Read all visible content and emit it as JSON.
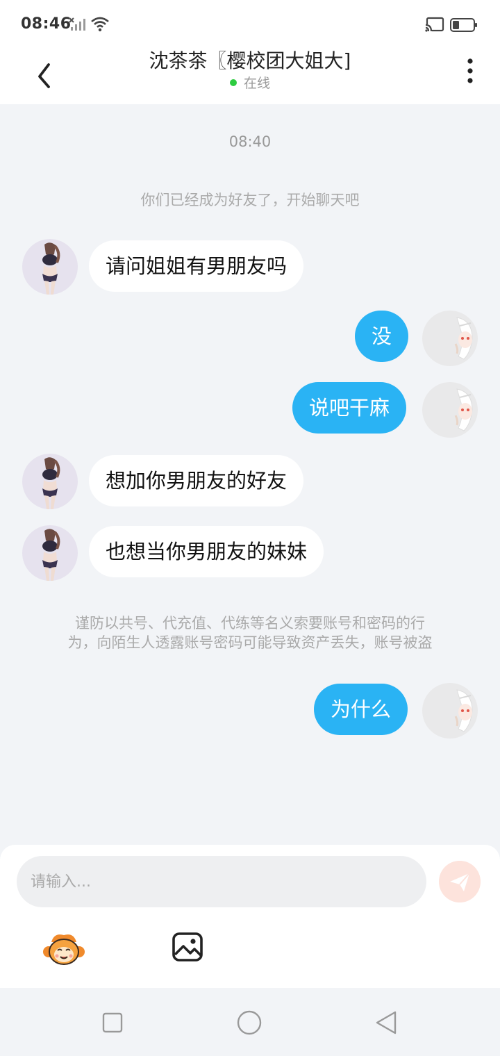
{
  "status_bar": {
    "time": "08:46",
    "icons": [
      "signal-x-icon",
      "wifi-icon",
      "cast-icon",
      "battery-icon"
    ]
  },
  "header": {
    "title": "沈茶茶〖樱校团大姐大]",
    "status": "在线",
    "status_color": "#2ecc40"
  },
  "chat": {
    "time_divider": "08:40",
    "system_notice": "你们已经成为好友了，开始聊天吧",
    "warning_line1": "谨防以共号、代充值、代练等名义索要账号和密码的行",
    "warning_line2": "为，向陌生人透露账号密码可能导致资产丢失，账号被盗",
    "messages": [
      {
        "side": "left",
        "text": "请问姐姐有男朋友吗"
      },
      {
        "side": "right",
        "text": "没"
      },
      {
        "side": "right",
        "text": "说吧干麻"
      },
      {
        "side": "left",
        "text": "想加你男朋友的好友"
      },
      {
        "side": "left",
        "text": "也想当你男朋友的妹妹"
      },
      {
        "side": "right",
        "text": "为什么"
      }
    ],
    "bubble_color_self": "#2ab3f4"
  },
  "input": {
    "placeholder": "请输入...",
    "value": ""
  },
  "toolbar": {
    "icons": [
      "emoji-mascot-icon",
      "image-icon"
    ]
  },
  "navbar": {
    "icons": [
      "recents-square-icon",
      "home-circle-icon",
      "back-triangle-icon"
    ]
  }
}
